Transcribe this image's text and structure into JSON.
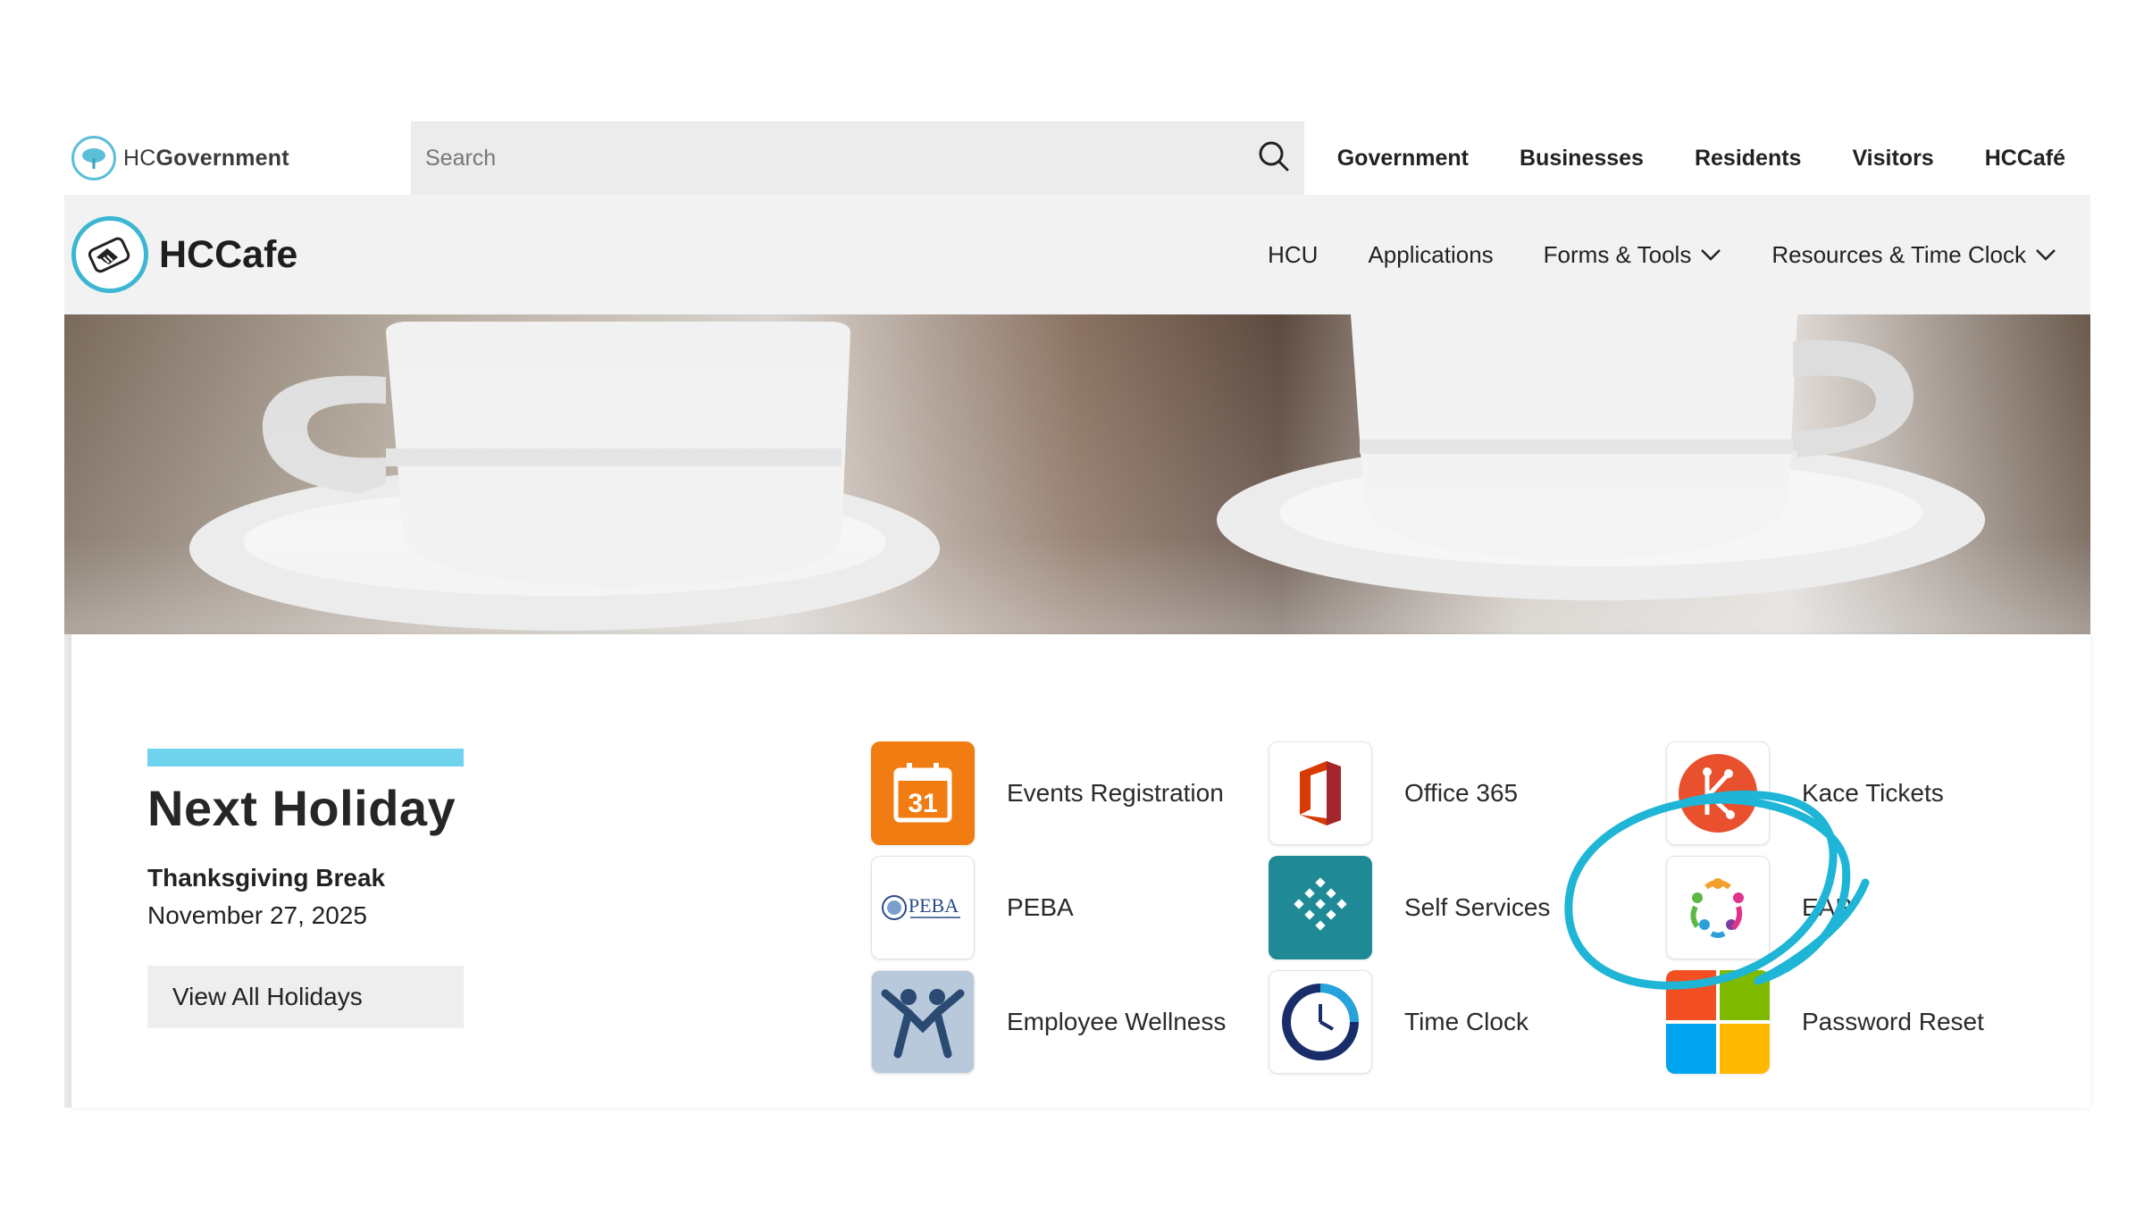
{
  "top_bar": {
    "logo_text_hc": "HC",
    "logo_text_bold": "Government",
    "search_placeholder": "Search",
    "nav": [
      "Government",
      "Businesses",
      "Residents",
      "Visitors",
      "HCCafé"
    ]
  },
  "site_header": {
    "title": "HCCafe",
    "nav": [
      {
        "label": "HCU",
        "dropdown": false
      },
      {
        "label": "Applications",
        "dropdown": false
      },
      {
        "label": "Forms & Tools",
        "dropdown": true
      },
      {
        "label": "Resources & Time Clock",
        "dropdown": true
      }
    ]
  },
  "holiday": {
    "heading": "Next Holiday",
    "name": "Thanksgiving Break",
    "date": "November 27, 2025",
    "button_label": "View All Holidays"
  },
  "tiles": [
    {
      "label": "Events Registration",
      "icon": "calendar-icon",
      "calendar_day": "31"
    },
    {
      "label": "Office 365",
      "icon": "office-365-icon"
    },
    {
      "label": "Kace Tickets",
      "icon": "kace-icon"
    },
    {
      "label": "PEBA",
      "icon": "peba-logo-icon",
      "logo_text": "PEBA"
    },
    {
      "label": "Self Services",
      "icon": "self-services-icon"
    },
    {
      "label": "EAP",
      "icon": "eap-icon"
    },
    {
      "label": "Employee Wellness",
      "icon": "wellness-icon"
    },
    {
      "label": "Time Clock",
      "icon": "time-clock-icon"
    },
    {
      "label": "Password Reset",
      "icon": "windows-icon"
    }
  ],
  "colors": {
    "accent": "#6fd3ee",
    "logo_ring": "#3cb6d3",
    "annotation": "#1fb5d6"
  }
}
